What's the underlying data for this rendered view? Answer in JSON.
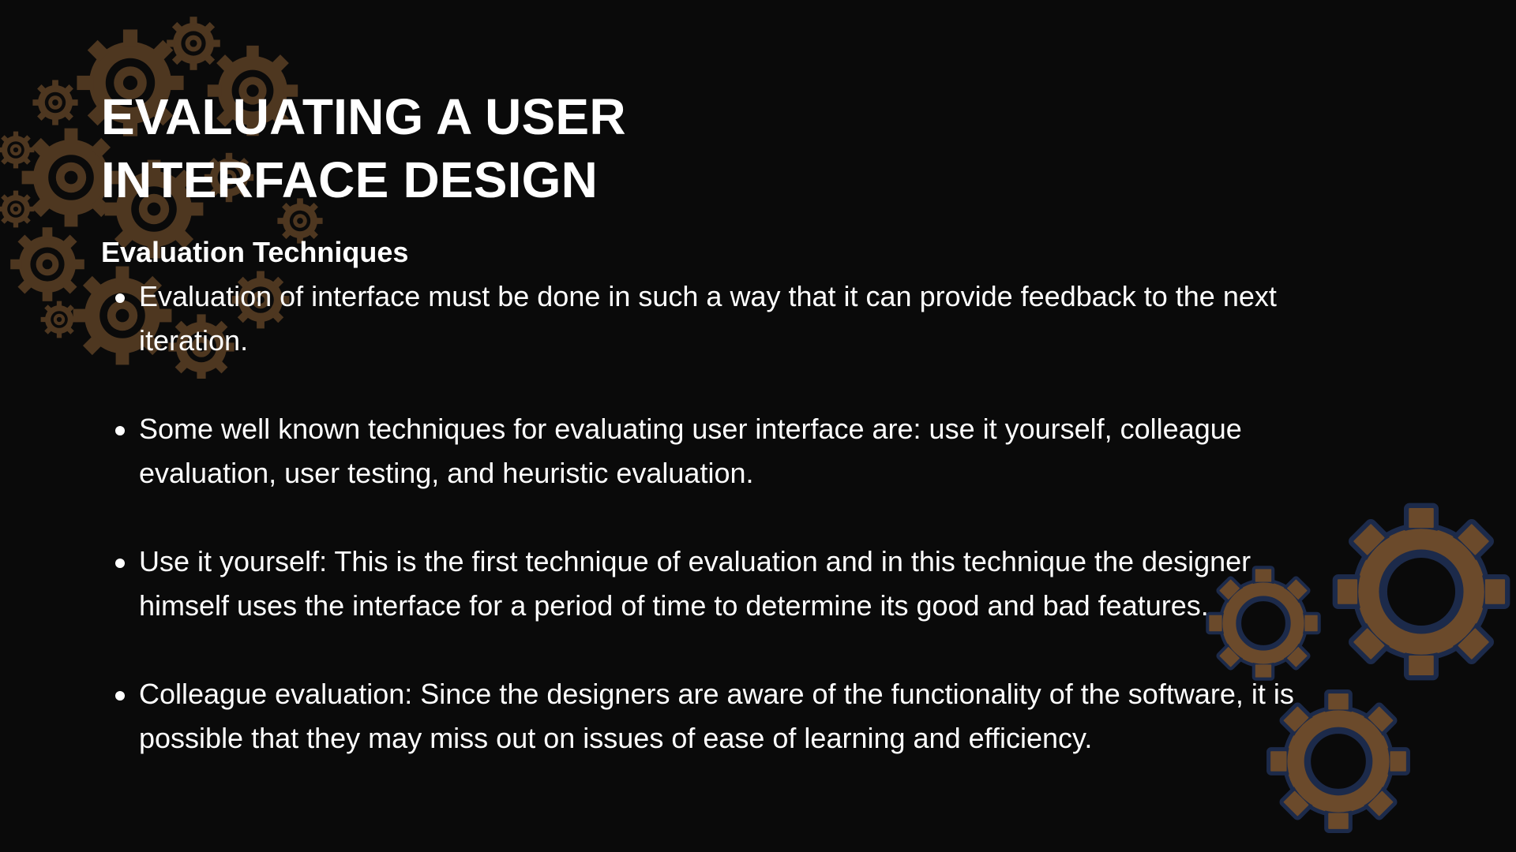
{
  "slide": {
    "title": "EVALUATING A USER INTERFACE DESIGN",
    "subtitle": "Evaluation Techniques",
    "bullets": [
      "Evaluation of interface must be done in such a way that it can provide feedback to the next iteration.",
      "Some well known techniques for evaluating user interface are: use it yourself, colleague evaluation, user testing, and heuristic evaluation.",
      "Use it yourself: This is the first technique of evaluation and in this technique the designer himself uses the interface for a period of time to determine its good and bad features.",
      "Colleague evaluation: Since the designers are aware of the functionality of the software, it is possible that they may miss out on issues of ease of learning and efficiency."
    ]
  },
  "decor": {
    "top_left_icon": "gears-cluster-icon",
    "bottom_right_icon": "gears-trio-icon",
    "gear_color": "#6b4a2b",
    "gear_outline_color": "#1c2a4a",
    "background_color": "#0a0a0a",
    "text_color": "#ffffff"
  }
}
